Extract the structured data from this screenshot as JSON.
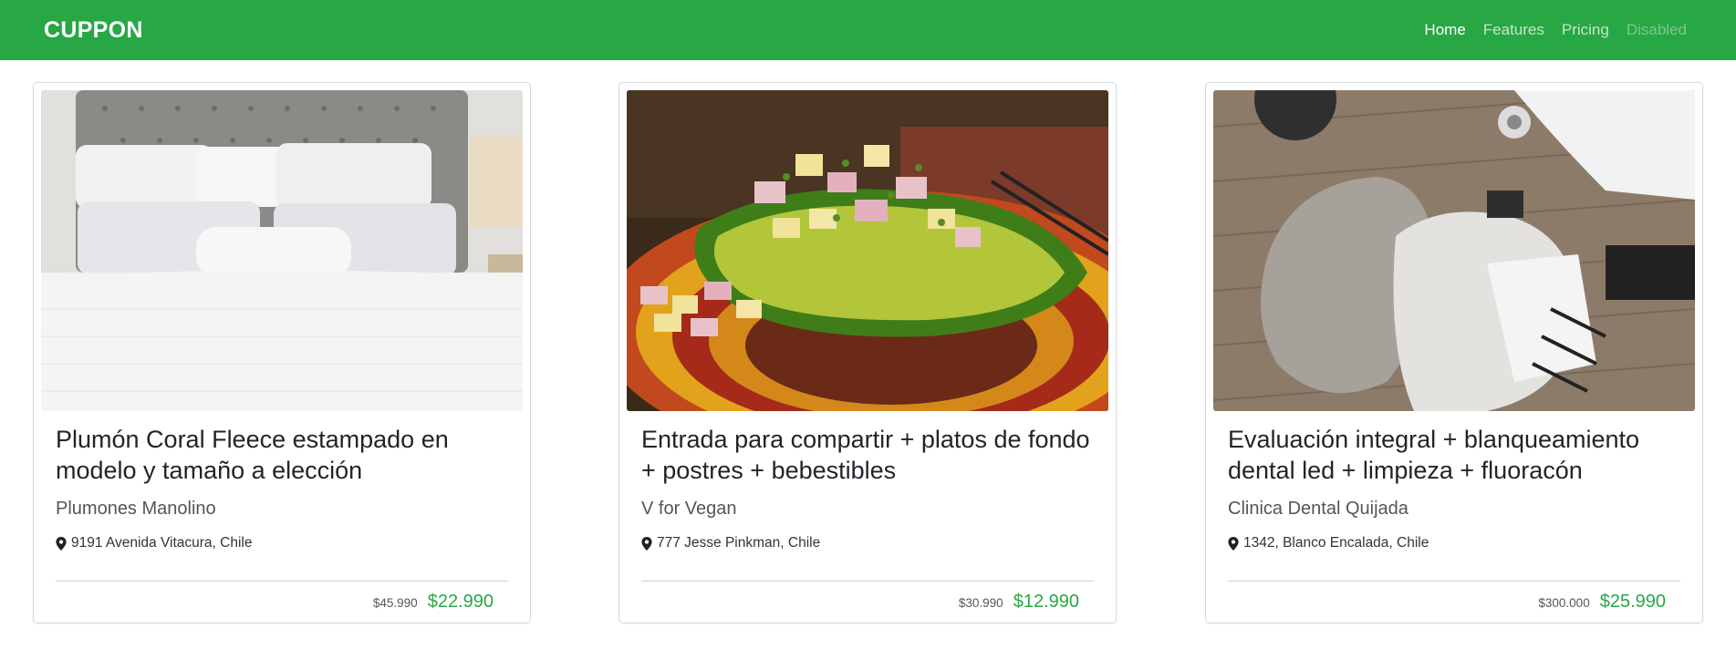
{
  "navbar": {
    "brand": "CUPPON",
    "links": [
      {
        "label": "Home",
        "state": "active"
      },
      {
        "label": "Features",
        "state": "normal"
      },
      {
        "label": "Pricing",
        "state": "normal"
      },
      {
        "label": "Disabled",
        "state": "disabled"
      }
    ],
    "background_color": "#28a745"
  },
  "cards": [
    {
      "title": "Plumón Coral Fleece estampado en modelo y tamaño a elección",
      "merchant": "Plumones Manolino",
      "location": "9191 Avenida Vitacura, Chile",
      "old_price": "$45.990",
      "new_price": "$22.990",
      "image": "bedroom-white-bedding-photo"
    },
    {
      "title": "Entrada para compartir + platos de fondo + postres + bebestibles",
      "merchant": "V for Vegan",
      "location": "777 Jesse Pinkman, Chile",
      "old_price": "$30.990",
      "new_price": "$12.990",
      "image": "stuffed-avocado-dish-photo"
    },
    {
      "title": "Evaluación integral + blanqueamiento dental led + limpieza + fluoracón",
      "merchant": "Clinica Dental Quijada",
      "location": "1342, Blanco Encalada, Chile",
      "old_price": "$300.000",
      "new_price": "$25.990",
      "image": "dental-chair-photo"
    }
  ],
  "icons": {
    "location": "map-marker-icon"
  },
  "colors": {
    "price_accent": "#28a745"
  }
}
